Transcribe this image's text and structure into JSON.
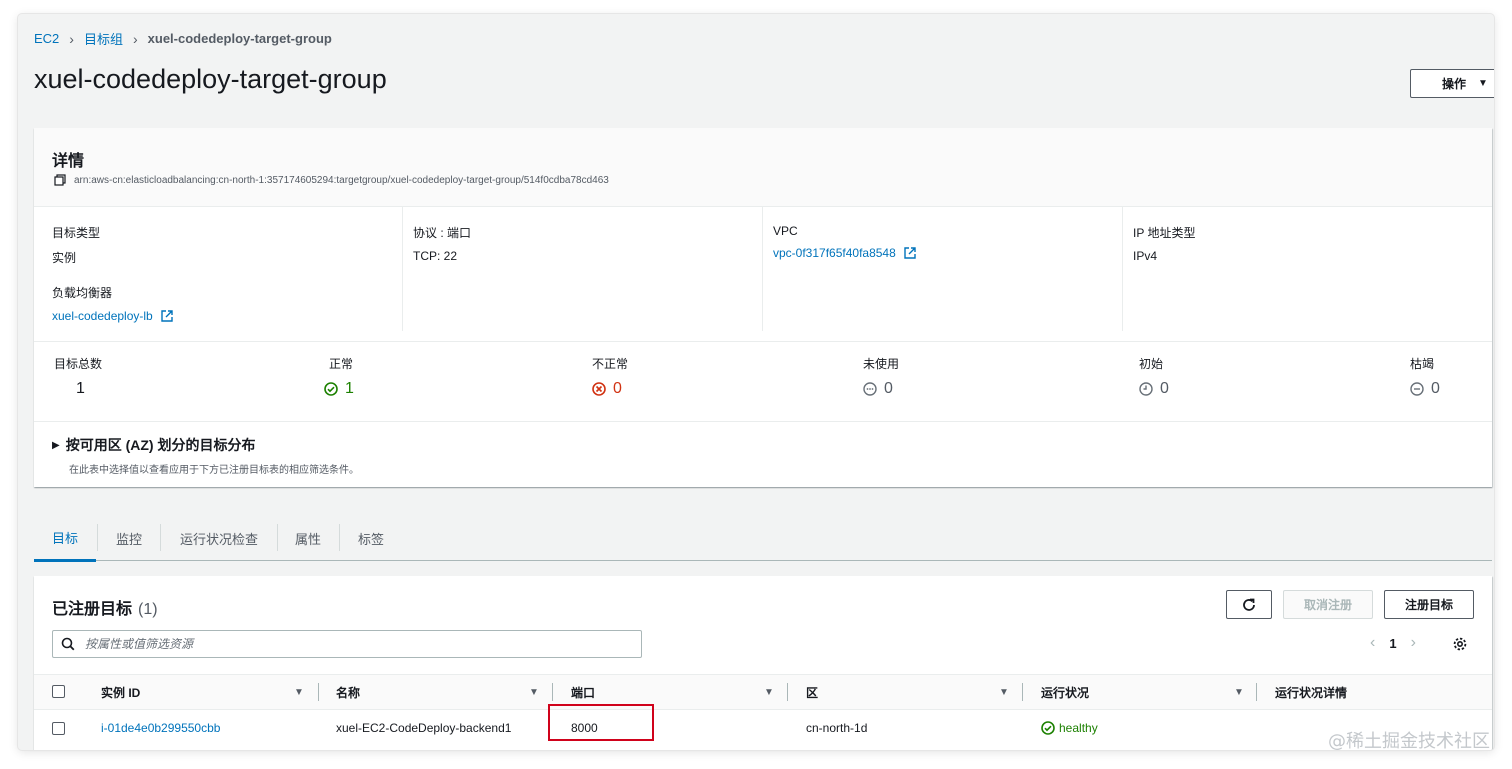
{
  "breadcrumb": {
    "root": "EC2",
    "mid": "目标组",
    "current": "xuel-codedeploy-target-group"
  },
  "page": {
    "title": "xuel-codedeploy-target-group",
    "actions_label": "操作"
  },
  "details": {
    "title": "详情",
    "arn": "arn:aws-cn:elasticloadbalancing:cn-north-1:357174605294:targetgroup/xuel-codedeploy-target-group/514f0cdba78cd463",
    "target_type_label": "目标类型",
    "target_type_value": "实例",
    "protocol_label": "协议 : 端口",
    "protocol_value": "TCP: 22",
    "vpc_label": "VPC",
    "vpc_value": "vpc-0f317f65f40fa8548",
    "ip_type_label": "IP 地址类型",
    "ip_type_value": "IPv4",
    "lb_label": "负载均衡器",
    "lb_value": "xuel-codedeploy-lb"
  },
  "stats": {
    "total_label": "目标总数",
    "total_value": "1",
    "healthy_label": "正常",
    "healthy_value": "1",
    "unhealthy_label": "不正常",
    "unhealthy_value": "0",
    "unused_label": "未使用",
    "unused_value": "0",
    "initial_label": "初始",
    "initial_value": "0",
    "draining_label": "枯竭",
    "draining_value": "0"
  },
  "az": {
    "title": "按可用区 (AZ) 划分的目标分布",
    "desc": "在此表中选择值以查看应用于下方已注册目标表的相应筛选条件。"
  },
  "tabs": [
    "目标",
    "监控",
    "运行状况检查",
    "属性",
    "标签"
  ],
  "targets": {
    "title": "已注册目标",
    "count": "(1)",
    "deregister_label": "取消注册",
    "register_label": "注册目标",
    "search_placeholder": "按属性或值筛选资源",
    "page": "1",
    "columns": [
      "实例 ID",
      "名称",
      "端口",
      "区",
      "运行状况",
      "运行状况详情"
    ],
    "rows": [
      {
        "instance_id": "i-01de4e0b299550cbb",
        "name": "xuel-EC2-CodeDeploy-backend1",
        "port": "8000",
        "zone": "cn-north-1d",
        "health": "healthy",
        "health_detail": ""
      }
    ]
  },
  "watermark": "@稀土掘金技术社区",
  "colors": {
    "link": "#0073bb",
    "healthy": "#1d8102",
    "unhealthy": "#d13212",
    "highlight": "#d0021b"
  }
}
